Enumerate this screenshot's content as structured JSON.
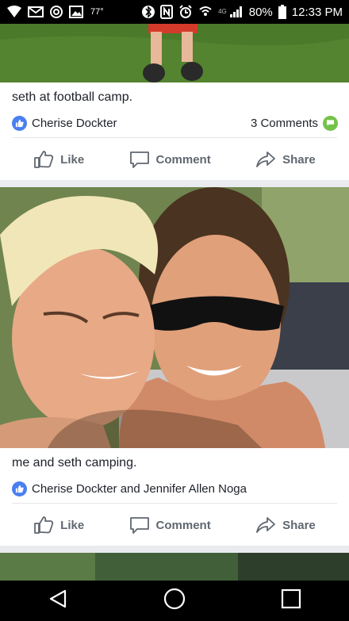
{
  "status_bar": {
    "temperature": "77°",
    "network_label": "4G",
    "battery": "80%",
    "time": "12:33 PM"
  },
  "posts": [
    {
      "caption": "seth at football camp.",
      "reactors": "Cherise Dockter",
      "comments": "3 Comments",
      "actions": {
        "like": "Like",
        "comment": "Comment",
        "share": "Share"
      }
    },
    {
      "caption": "me and seth camping.",
      "reactors": "Cherise Dockter and Jennifer Allen Noga",
      "actions": {
        "like": "Like",
        "comment": "Comment",
        "share": "Share"
      }
    }
  ],
  "colors": {
    "like_blue": "#4a7ff0",
    "comment_green": "#75c24b",
    "action_gray": "#606770"
  }
}
